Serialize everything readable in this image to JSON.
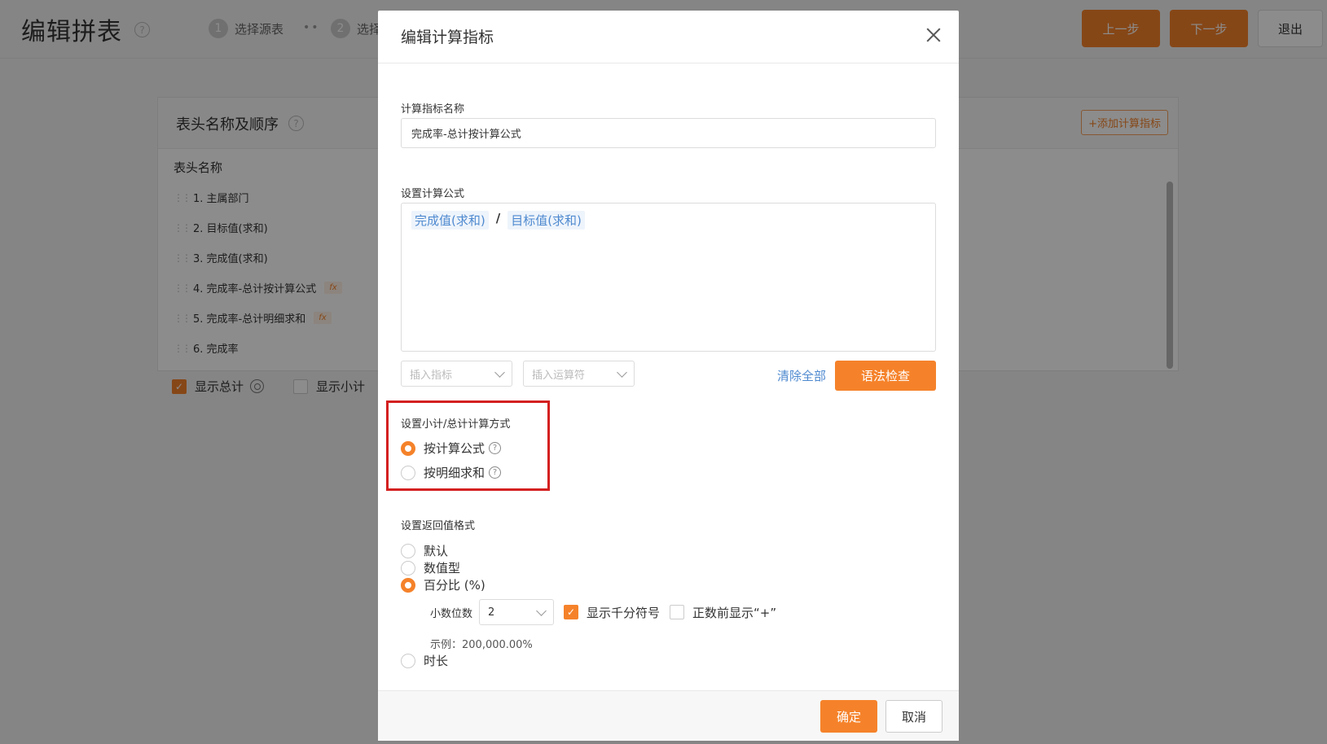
{
  "app": {
    "title": "编辑拼表",
    "steps": [
      {
        "num": "1",
        "label": "选择源表"
      },
      {
        "num": "2",
        "label": "选择"
      }
    ],
    "buttons": {
      "prev": "上一步",
      "next": "下一步",
      "exit": "退出"
    }
  },
  "panel": {
    "title": "表头名称及顺序",
    "add_calc_label": "+添加计算指标",
    "column_header": "表头名称",
    "rows": [
      {
        "label": "1. 主属部门",
        "badge": ""
      },
      {
        "label": "2. 目标值(求和)",
        "badge": ""
      },
      {
        "label": "3. 完成值(求和)",
        "badge": ""
      },
      {
        "label": "4. 完成率-总计按计算公式",
        "badge": "fx"
      },
      {
        "label": "5. 完成率-总计明细求和",
        "badge": "fx"
      },
      {
        "label": "6. 完成率",
        "badge": ""
      }
    ],
    "show_total": "显示总计",
    "show_subtotal": "显示小计"
  },
  "modal": {
    "title": "编辑计算指标",
    "name_label": "计算指标名称",
    "name_value": "完成率-总计按计算公式",
    "formula_label": "设置计算公式",
    "formula": {
      "left": "完成值(求和)",
      "operator": "/",
      "right": "目标值(求和)"
    },
    "insert_metric_placeholder": "插入指标",
    "insert_operator_placeholder": "插入运算符",
    "clear_all": "清除全部",
    "syntax_check": "语法检查",
    "subtotal_label": "设置小计/总计计算方式",
    "subtotal_options": [
      {
        "label": "按计算公式",
        "selected": true
      },
      {
        "label": "按明细求和",
        "selected": false
      }
    ],
    "return_format_label": "设置返回值格式",
    "format_options": [
      {
        "label": "默认",
        "selected": false
      },
      {
        "label": "数值型",
        "selected": false
      },
      {
        "label": "百分比 (%)",
        "selected": true
      },
      {
        "label": "时长",
        "selected": false
      }
    ],
    "decimal_label": "小数位数",
    "decimal_value": "2",
    "thousands_sep": "显示千分符号",
    "thousands_checked": true,
    "plus_sign": "正数前显示“+”",
    "plus_checked": false,
    "example": "示例：200,000.00%",
    "ok": "确定",
    "cancel": "取消"
  },
  "colors": {
    "accent": "#f5822a",
    "link": "#4f8ad0",
    "highlight": "#d42020"
  }
}
